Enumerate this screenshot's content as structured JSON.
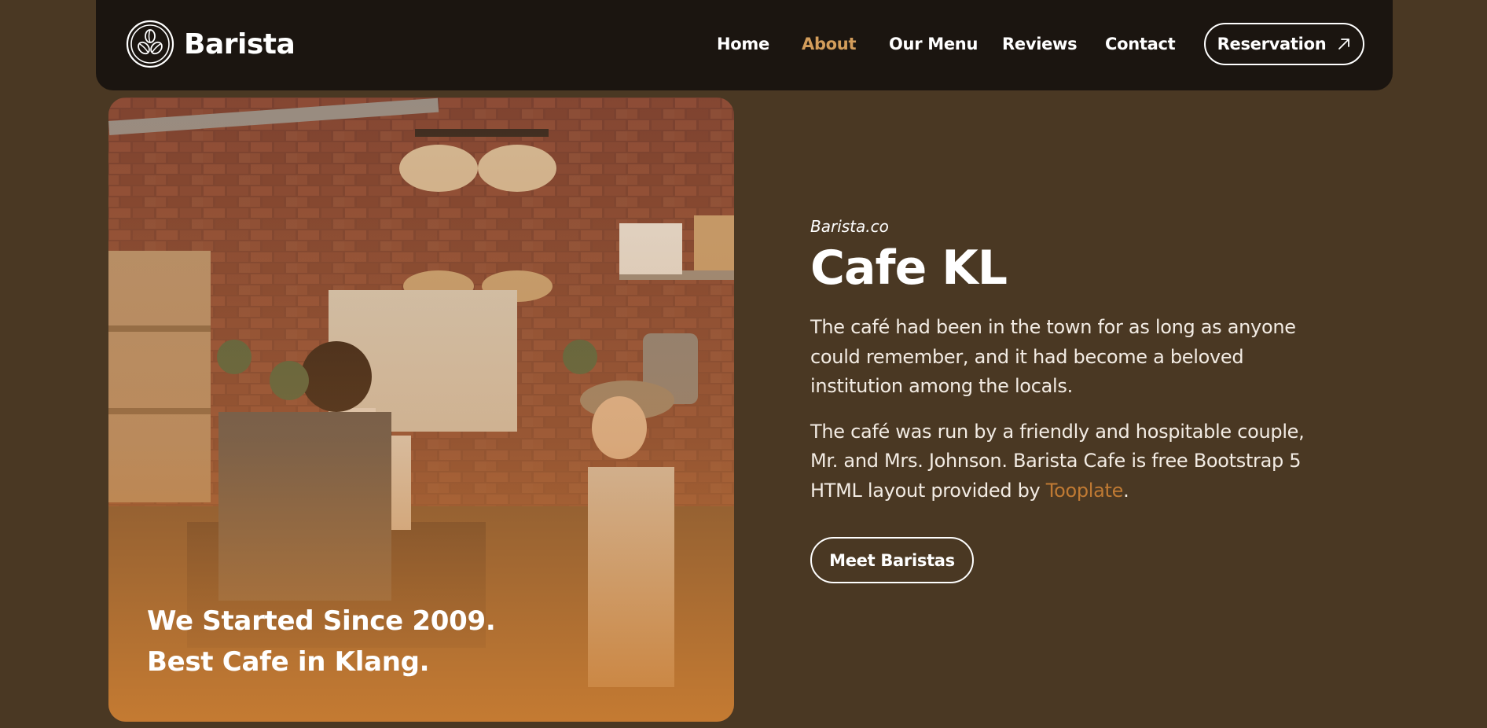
{
  "brand": {
    "name": "Barista",
    "logo_icon": "coffee-beans-icon"
  },
  "nav": {
    "items": [
      {
        "label": "Home",
        "active": false
      },
      {
        "label": "About",
        "active": true
      },
      {
        "label": "Our Menu",
        "active": false
      },
      {
        "label": "Reviews",
        "active": false
      },
      {
        "label": "Contact",
        "active": false
      }
    ],
    "reservation_label": "Reservation",
    "reservation_icon": "arrow-up-right-icon"
  },
  "photo": {
    "caption_line1": "We Started Since 2009.",
    "caption_line2": "Best Cafe in Klang."
  },
  "about": {
    "eyebrow": "Barista.co",
    "title": "Cafe KL",
    "paragraph1": "The café had been in the town for as long as anyone could remember, and it had become a beloved institution among the locals.",
    "paragraph2_prefix": "The café was run by a friendly and hospitable couple, Mr. and Mrs. Johnson. Barista Cafe is free Bootstrap 5 HTML layout provided by ",
    "paragraph2_link": "Tooplate",
    "paragraph2_suffix": ".",
    "button_label": "Meet Baristas"
  },
  "colors": {
    "background": "#4a3823",
    "navbar": "#1b1510",
    "accent": "#d39d5b",
    "link": "#c07a33"
  }
}
